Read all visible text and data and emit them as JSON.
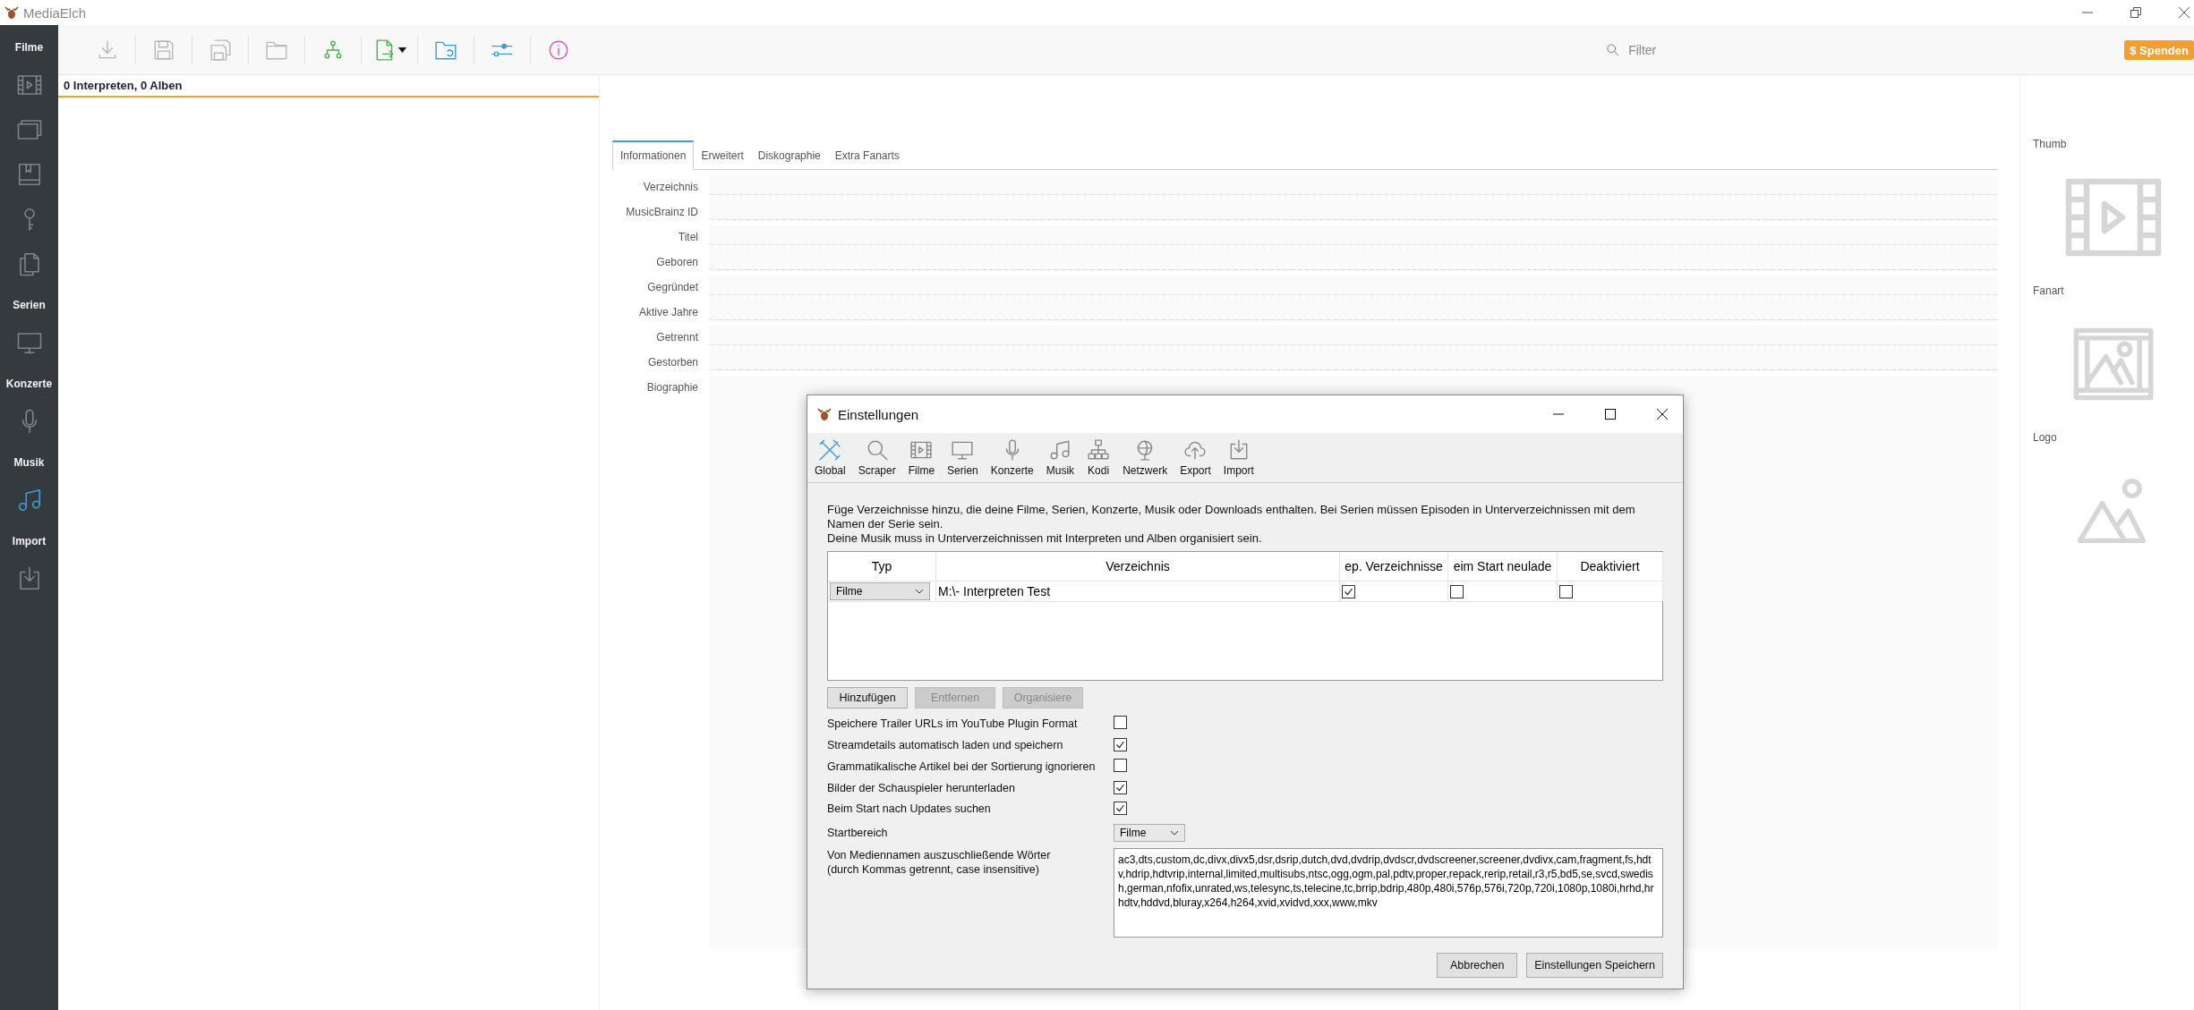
{
  "window": {
    "title": "MediaElch"
  },
  "sidebar": {
    "sections": [
      {
        "label": "Filme",
        "items": [
          {
            "kind": "film",
            "selected": false
          },
          {
            "kind": "windows",
            "selected": false
          },
          {
            "kind": "book",
            "selected": false
          },
          {
            "kind": "key",
            "selected": false
          },
          {
            "kind": "documents",
            "selected": false
          }
        ]
      },
      {
        "label": "Serien",
        "items": [
          {
            "kind": "monitor",
            "selected": false
          }
        ]
      },
      {
        "label": "Konzerte",
        "items": [
          {
            "kind": "mic",
            "selected": false
          }
        ]
      },
      {
        "label": "Musik",
        "items": [
          {
            "kind": "music",
            "selected": true
          }
        ]
      },
      {
        "label": "Import",
        "items": [
          {
            "kind": "import",
            "selected": false
          }
        ]
      }
    ]
  },
  "toolbar": {
    "buttons": [
      {
        "kind": "download",
        "disabled": true
      },
      {
        "kind": "save",
        "disabled": true
      },
      {
        "kind": "saveall",
        "disabled": true
      },
      {
        "kind": "folder",
        "disabled": true
      },
      {
        "kind": "tree",
        "disabled": false
      },
      {
        "kind": "export",
        "disabled": false
      },
      {
        "kind": "reload",
        "disabled": false
      },
      {
        "kind": "sliders",
        "disabled": false
      },
      {
        "kind": "info",
        "disabled": false
      }
    ],
    "filter": {
      "placeholder": "Filter"
    },
    "donate": {
      "symbol": "$",
      "label": "Spenden"
    }
  },
  "list": {
    "header": "0 Interpreten, 0 Alben"
  },
  "tabs": [
    {
      "label": "Informationen",
      "selected": true
    },
    {
      "label": "Erweitert",
      "selected": false
    },
    {
      "label": "Diskographie",
      "selected": false
    },
    {
      "label": "Extra Fanarts",
      "selected": false
    }
  ],
  "fields": [
    {
      "label": "Verzeichnis",
      "kind": "line"
    },
    {
      "label": "MusicBrainz ID",
      "kind": "line"
    },
    {
      "label": "Titel",
      "kind": "line"
    },
    {
      "label": "Geboren",
      "kind": "line"
    },
    {
      "label": "Gegründet",
      "kind": "line"
    },
    {
      "label": "Aktive Jahre",
      "kind": "line"
    },
    {
      "label": "Getrennt",
      "kind": "line"
    },
    {
      "label": "Gestorben",
      "kind": "line"
    },
    {
      "label": "Biographie",
      "kind": "text"
    }
  ],
  "images": [
    {
      "label": "Thumb",
      "kind": "film"
    },
    {
      "label": "Fanart",
      "kind": "filmimage"
    },
    {
      "label": "Logo",
      "kind": "image"
    }
  ],
  "dialog": {
    "title": "Einstellungen",
    "sections": [
      {
        "label": "Global",
        "kind": "tools",
        "selected": true
      },
      {
        "label": "Scraper",
        "kind": "search",
        "selected": false
      },
      {
        "label": "Filme",
        "kind": "film",
        "selected": false
      },
      {
        "label": "Serien",
        "kind": "monitor",
        "selected": false
      },
      {
        "label": "Konzerte",
        "kind": "mic",
        "selected": false
      },
      {
        "label": "Musik",
        "kind": "music",
        "selected": false
      },
      {
        "label": "Kodi",
        "kind": "network",
        "selected": false
      },
      {
        "label": "Netzwerk",
        "kind": "globe",
        "selected": false
      },
      {
        "label": "Export",
        "kind": "cloud",
        "selected": false
      },
      {
        "label": "Import",
        "kind": "import",
        "selected": false
      }
    ],
    "intro": [
      "Füge Verzeichnisse hinzu, die deine Filme, Serien, Konzerte, Musik oder Downloads enthalten. Bei Serien müssen Episoden in Unterverzeichnissen mit dem Namen der Serie sein.",
      "Deine Musik muss in Unterverzeichnissen mit Interpreten und Alben organisiert sein."
    ],
    "table": {
      "columns": [
        "Typ",
        "Verzeichnis",
        "ep. Verzeichnisse",
        "eim Start neulade",
        "Deaktiviert"
      ],
      "rows": [
        {
          "type": "Filme",
          "directory": "M:\\- Interpreten Test",
          "separate": true,
          "reload": false,
          "disabled": false
        }
      ]
    },
    "buttons": [
      {
        "label": "Hinzufügen",
        "disabled": false
      },
      {
        "label": "Entfernen",
        "disabled": true
      },
      {
        "label": "Organisiere",
        "disabled": true
      }
    ],
    "options": [
      {
        "label": "Speichere Trailer URLs im YouTube Plugin Format",
        "checked": false
      },
      {
        "label": "Streamdetails automatisch laden und speichern",
        "checked": true
      },
      {
        "label": "Grammatikalische Artikel bei der Sortierung ignorieren",
        "checked": false
      },
      {
        "label": "Bilder der Schauspieler herunterladen",
        "checked": true
      },
      {
        "label": "Beim Start nach Updates suchen",
        "checked": true
      }
    ],
    "start_area": {
      "label": "Startbereich",
      "value": "Filme"
    },
    "exclude": {
      "label": "Von Mediennamen auszuschließende Wörter (durch Kommas getrennt, case insensitive)",
      "value": "ac3,dts,custom,dc,divx,divx5,dsr,dsrip,dutch,dvd,dvdrip,dvdscr,dvdscreener,screener,dvdivx,cam,fragment,fs,hdtv,hdrip,hdtvrip,internal,limited,multisubs,ntsc,ogg,ogm,pal,pdtv,proper,repack,rerip,retail,r3,r5,bd5,se,svcd,swedish,german,nfofix,unrated,ws,telesync,ts,telecine,tc,brrip,bdrip,480p,480i,576p,576i,720p,720i,1080p,1080i,hrhd,hrhdtv,hddvd,bluray,x264,h264,xvid,xvidvd,xxx,www,mkv"
    },
    "footer_buttons": [
      "Abbrechen",
      "Einstellungen Speichern"
    ]
  }
}
